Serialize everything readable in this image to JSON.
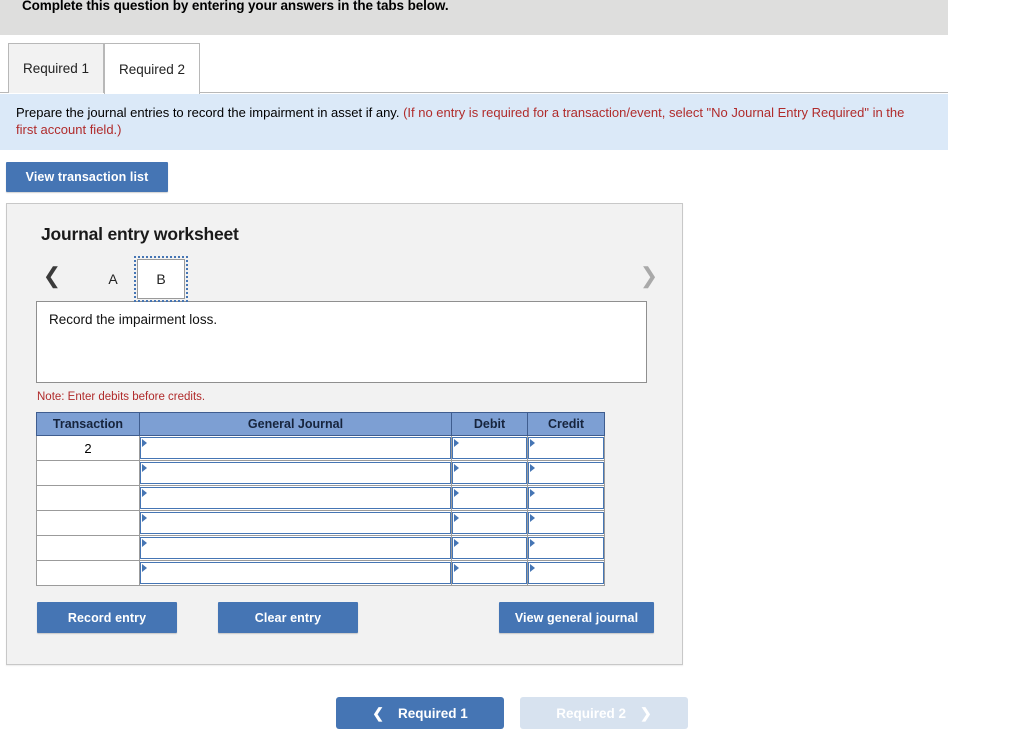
{
  "header": {
    "instruction": "Complete this question by entering your answers in the tabs below."
  },
  "tabs": [
    {
      "label": "Required 1",
      "active": false
    },
    {
      "label": "Required 2",
      "active": true
    }
  ],
  "instruction_band": {
    "main_text": "Prepare the journal entries to record the impairment in asset if any. ",
    "red_text": "(If no entry is required for a transaction/event, select \"No Journal Entry Required\" in the first account field.)"
  },
  "toolbar": {
    "view_transaction_list_label": "View transaction list"
  },
  "worksheet": {
    "title": "Journal entry worksheet",
    "pager": {
      "prev_icon": "chevron-left-icon",
      "next_icon": "chevron-right-icon",
      "items": [
        {
          "label": "A",
          "active": false
        },
        {
          "label": "B",
          "active": true
        }
      ]
    },
    "description": "Record the impairment loss.",
    "note": "Note: Enter debits before credits.",
    "table": {
      "columns": [
        "Transaction",
        "General Journal",
        "Debit",
        "Credit"
      ],
      "rows": [
        {
          "transaction": "2",
          "general_journal": "",
          "debit": "",
          "credit": ""
        },
        {
          "transaction": "",
          "general_journal": "",
          "debit": "",
          "credit": ""
        },
        {
          "transaction": "",
          "general_journal": "",
          "debit": "",
          "credit": ""
        },
        {
          "transaction": "",
          "general_journal": "",
          "debit": "",
          "credit": ""
        },
        {
          "transaction": "",
          "general_journal": "",
          "debit": "",
          "credit": ""
        },
        {
          "transaction": "",
          "general_journal": "",
          "debit": "",
          "credit": ""
        }
      ]
    },
    "actions": {
      "record_entry_label": "Record entry",
      "clear_entry_label": "Clear entry",
      "view_general_journal_label": "View general journal"
    }
  },
  "bottom_nav": {
    "prev": {
      "label": "Required 1",
      "icon": "chevron-left-icon",
      "disabled": false
    },
    "next": {
      "label": "Required 2",
      "icon": "chevron-right-icon",
      "disabled": true
    }
  },
  "colors": {
    "accent_blue": "#4575b4",
    "table_header_blue": "#7d9fd3",
    "band_blue": "#dbe9f8",
    "red_text": "#b02b2b",
    "disabled_blue": "#d7e2ef"
  }
}
